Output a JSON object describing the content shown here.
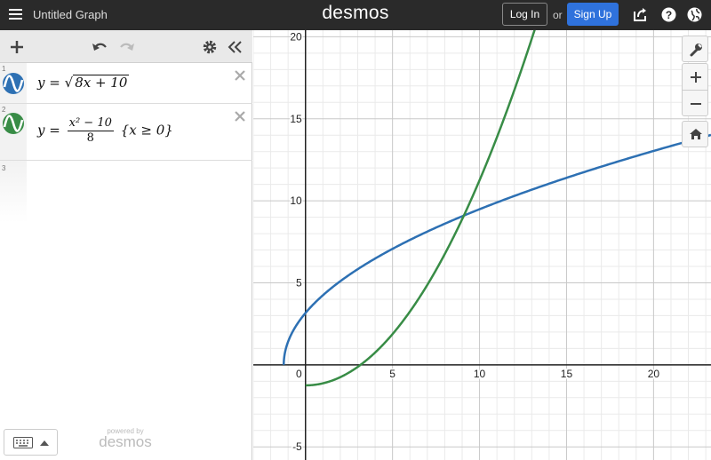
{
  "header": {
    "title": "Untitled Graph",
    "brand": "desmos",
    "login_label": "Log In",
    "or_text": "or",
    "signup_label": "Sign Up",
    "icons": [
      "menu-icon",
      "share-icon",
      "help-icon",
      "globe-icon"
    ]
  },
  "toolbar": {
    "icons": [
      "add-icon",
      "undo-icon",
      "redo-icon",
      "settings-icon",
      "collapse-icon"
    ]
  },
  "expressions": [
    {
      "index": "1",
      "color": "#2d70b3",
      "lhs": "y",
      "eq": "=",
      "radicand": "8x + 10"
    },
    {
      "index": "2",
      "color": "#388c46",
      "lhs": "y",
      "eq": "=",
      "numerator": "x² − 10",
      "denominator": "8",
      "restriction": "{x ≥ 0}"
    },
    {
      "index": "3"
    }
  ],
  "footer": {
    "powered_by": "powered by",
    "brand": "desmos"
  },
  "graph_tools": [
    "wrench-icon",
    "zoom-in-icon",
    "zoom-out-icon",
    "home-icon"
  ],
  "chart_data": {
    "type": "line",
    "xlim": [
      -3,
      23.3
    ],
    "ylim": [
      -5.8,
      20.4
    ],
    "grid": true,
    "x_ticks": [
      5,
      10,
      15,
      20
    ],
    "y_ticks": [
      -5,
      5,
      10,
      15,
      20
    ],
    "tick_labels_x": [
      "0",
      "5",
      "10",
      "15",
      "20"
    ],
    "tick_labels_y": [
      "-5",
      "5",
      "10",
      "15",
      "20"
    ],
    "series": [
      {
        "expr": "y = sqrt(8x + 10)",
        "color": "#2d70b3",
        "domain": [
          -1.25,
          23.3
        ]
      },
      {
        "expr": "y = (x^2 - 10)/8, x >= 0",
        "color": "#388c46",
        "domain": [
          0,
          13.3
        ]
      }
    ]
  }
}
